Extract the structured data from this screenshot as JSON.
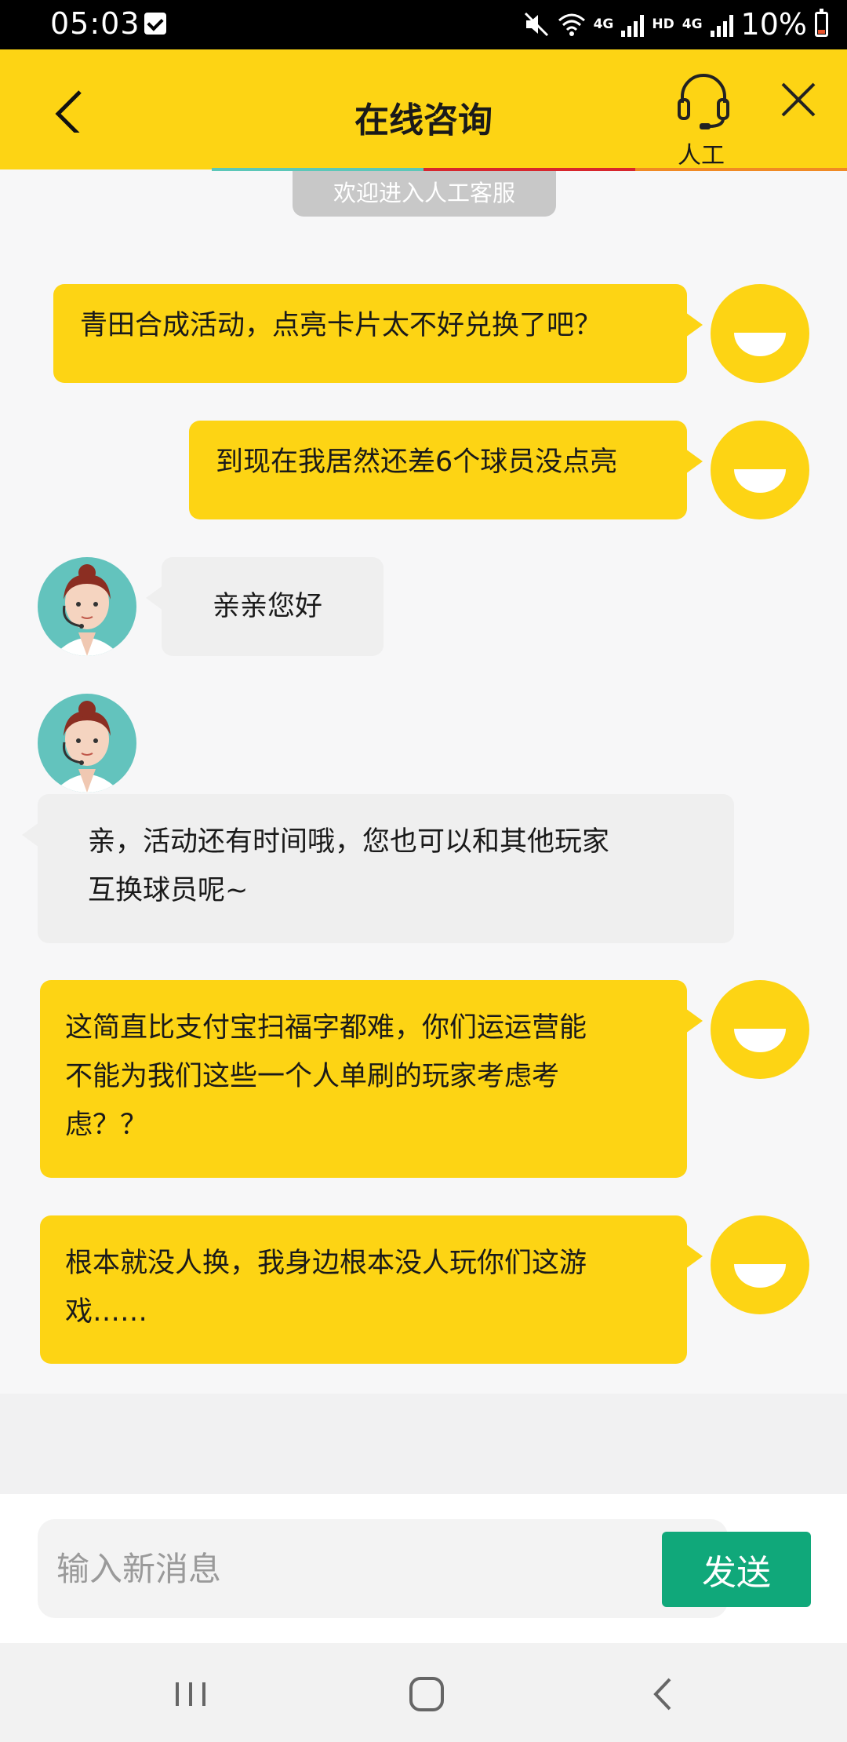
{
  "status_bar": {
    "time": "05:03",
    "network_4g_1": "4G",
    "network_hd": "HD",
    "network_4g_2": "4G",
    "battery": "10%",
    "icons": [
      "notification-check-icon",
      "mute-icon",
      "wifi-icon",
      "signal-icon",
      "battery-icon"
    ]
  },
  "header": {
    "title": "在线咨询",
    "agent_label": "人工",
    "icons": [
      "back-arrow-icon",
      "headset-icon",
      "close-icon"
    ],
    "background": "#fdd414"
  },
  "notice": "欢迎进入人工客服",
  "messages": [
    {
      "sender": "user",
      "text": "青田合成活动，点亮卡片太不好兑换了吧？"
    },
    {
      "sender": "user",
      "text": "到现在我居然还差6个球员没点亮"
    },
    {
      "sender": "agent",
      "text": "亲亲您好"
    },
    {
      "sender": "agent",
      "lines": [
        "亲，活动还有时间哦，您也可以和其他玩家",
        "互换球员呢~"
      ]
    },
    {
      "sender": "user",
      "lines": [
        "这简直比支付宝扫福字都难，你们运运营能",
        "不能为我们这些一个人单刷的玩家考虑考",
        "虑？？"
      ]
    },
    {
      "sender": "user",
      "lines": [
        "根本就没人换，我身边根本没人玩你们这游",
        "戏……"
      ]
    }
  ],
  "input": {
    "placeholder": "输入新消息",
    "value": ""
  },
  "send_label": "发送",
  "colors": {
    "accent": "#fdd414",
    "send": "#10a87a",
    "agent_bubble": "#efefef"
  },
  "nav_icons": [
    "recent-apps-icon",
    "home-icon",
    "nav-back-icon"
  ]
}
